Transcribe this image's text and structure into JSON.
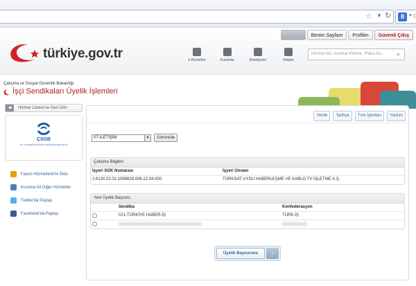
{
  "browser": {
    "search_engine_label": "Go",
    "search_badge": "8"
  },
  "header": {
    "top_links": {
      "home": "Benim Sayfam",
      "profile": "Profilim",
      "logout": "Güvenli Çıkış"
    },
    "logo_text": "türkiye.gov.tr",
    "nav": [
      {
        "label": "e-Hizmetler"
      },
      {
        "label": "Kurumlar"
      },
      {
        "label": "Belediyeler"
      },
      {
        "label": "İletişim"
      }
    ],
    "search_placeholder": "Hizmet Adı, Anahtar Kelime, Plaka No..."
  },
  "page": {
    "ministry": "Çalışma ve Sosyal Güvenlik Bakanlığı",
    "title": "İşçi Sendikaları Üyelik İşlemleri"
  },
  "sidebar": {
    "back_label": "Hizmet Listesi'ne Geri Dön",
    "org_short": "ÇSGB",
    "org_sub": "T.C. ÇALIŞMA VE SOSYAL GÜVENLİK BAKANLIĞI",
    "links": [
      {
        "label": "Favori Hizmetlerim'e Ekle",
        "color": "#e5a100"
      },
      {
        "label": "Kuruma Ait Diğer Hizmetler",
        "color": "#4a7fb8"
      },
      {
        "label": "Twitter'da Paylaş",
        "color": "#5aaee8"
      },
      {
        "label": "Facebook'da Paylaş",
        "color": "#3b5a99"
      }
    ]
  },
  "actions": {
    "refresh": "Yenile",
    "history": "Tarihçe",
    "all_workplaces": "Tüm İşkolları",
    "help": "Yardım"
  },
  "filter": {
    "selected": "07-İLETİŞİM",
    "show_button": "Görüntüle"
  },
  "work_info": {
    "title": "Çalışma Bilgileri",
    "headers": {
      "sgk": "İşyeri SGK Numarası",
      "name": "İşyeri Ünvanı"
    },
    "row": {
      "sgk": "2.6130.02.02.1089828.006.22.04.000",
      "name": "TÜRKSAT UYDU HABERLEŞME VE KABLO TV İŞLETME A.Ş."
    }
  },
  "membership": {
    "title": "Yeni Üyelik Başvuru",
    "headers": {
      "union": "Sendika",
      "confederation": "Konfederasyon"
    },
    "rows": [
      {
        "union": "021-TÜRKİYE HABER-İŞ",
        "confederation": "TÜRK-İŞ"
      },
      {
        "union": "",
        "confederation": ""
      }
    ],
    "apply_button": "Üyelik Başvurusu"
  }
}
